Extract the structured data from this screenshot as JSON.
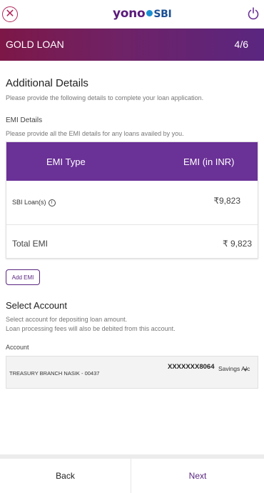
{
  "topbar": {
    "logo_main": "yono",
    "logo_sub": "SBI",
    "close_icon": "close-circle-icon",
    "power_icon": "power-icon"
  },
  "header": {
    "title": "GOLD LOAN",
    "step": "4/6"
  },
  "additional": {
    "title": "Additional Details",
    "hint": "Please provide the following details to complete your loan application."
  },
  "emi_section": {
    "label": "EMI Details",
    "hint": "Please provide all the EMI details for any loans availed by you.",
    "col_type": "EMI Type",
    "col_amount": "EMI (in INR)",
    "rows": [
      {
        "type": "SBI Loan(s)",
        "amount": "₹9,823"
      }
    ],
    "total_label": "Total EMI",
    "total_value": "₹ 9,823",
    "add_button": "Add EMI"
  },
  "account_section": {
    "title": "Select Account",
    "hint_line1": "Select account for depositing loan amount.",
    "hint_line2": "Loan processing fees will also be debited from this account.",
    "field_label": "Account",
    "branch": "TREASURY BRANCH NASIK - 00437",
    "number": "XXXXXXX8064",
    "type": "Savings A/c"
  },
  "footer": {
    "back": "Back",
    "next": "Next"
  },
  "colors": {
    "brand_purple": "#5a2680",
    "header_start": "#7d1747",
    "table_head": "#6a3196",
    "close_red": "#b0265a"
  }
}
